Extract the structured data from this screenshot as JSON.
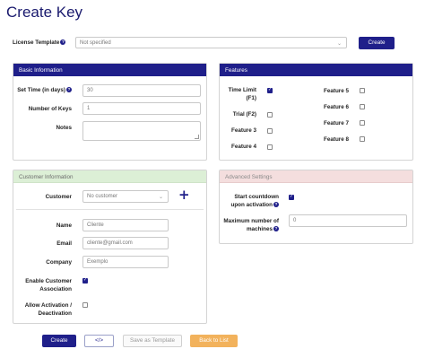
{
  "page": {
    "title": "Create Key"
  },
  "template_bar": {
    "label": "License Template",
    "select_value": "Not specified",
    "create_label": "Create"
  },
  "basic": {
    "header": "Basic Information",
    "set_time_label": "Set Time (in days)",
    "set_time_value": "30",
    "num_keys_label": "Number of Keys",
    "num_keys_value": "1",
    "notes_label": "Notes"
  },
  "features": {
    "header": "Features",
    "items": [
      {
        "label": "Time Limit (F1)",
        "checked": true
      },
      {
        "label": "Trial (F2)",
        "checked": false
      },
      {
        "label": "Feature 3",
        "checked": false
      },
      {
        "label": "Feature 4",
        "checked": false
      },
      {
        "label": "Feature 5",
        "checked": false
      },
      {
        "label": "Feature 6",
        "checked": false
      },
      {
        "label": "Feature 7",
        "checked": false
      },
      {
        "label": "Feature 8",
        "checked": false
      }
    ],
    "time_limit_line1": "Time Limit",
    "time_limit_line2": "(F1)"
  },
  "customer": {
    "header": "Customer Information",
    "customer_label": "Customer",
    "customer_select": "No customer",
    "add_icon": "+",
    "name_label": "Name",
    "name_placeholder": "Cliente",
    "email_label": "Email",
    "email_placeholder": "cliente@gmail.com",
    "company_label": "Company",
    "company_placeholder": "Exemplo",
    "enable_assoc_line1": "Enable Customer",
    "enable_assoc_line2": "Association",
    "enable_assoc_checked": true,
    "allow_act_line1": "Allow Activation /",
    "allow_act_line2": "Deactivation",
    "allow_act_checked": false
  },
  "advanced": {
    "header": "Advanced Settings",
    "countdown_line1": "Start countdown",
    "countdown_line2": "upon activation",
    "countdown_checked": true,
    "max_machines_line1": "Maximum number of",
    "max_machines_line2": "machines",
    "max_machines_value": "0"
  },
  "footer": {
    "create": "Create",
    "code": "</>",
    "save_template": "Save as Template",
    "back": "Back to List"
  },
  "colors": {
    "primary": "#1f1f8a",
    "orange": "#f2b25c",
    "green_header": "#dcefd6",
    "red_header": "#f4dede"
  }
}
